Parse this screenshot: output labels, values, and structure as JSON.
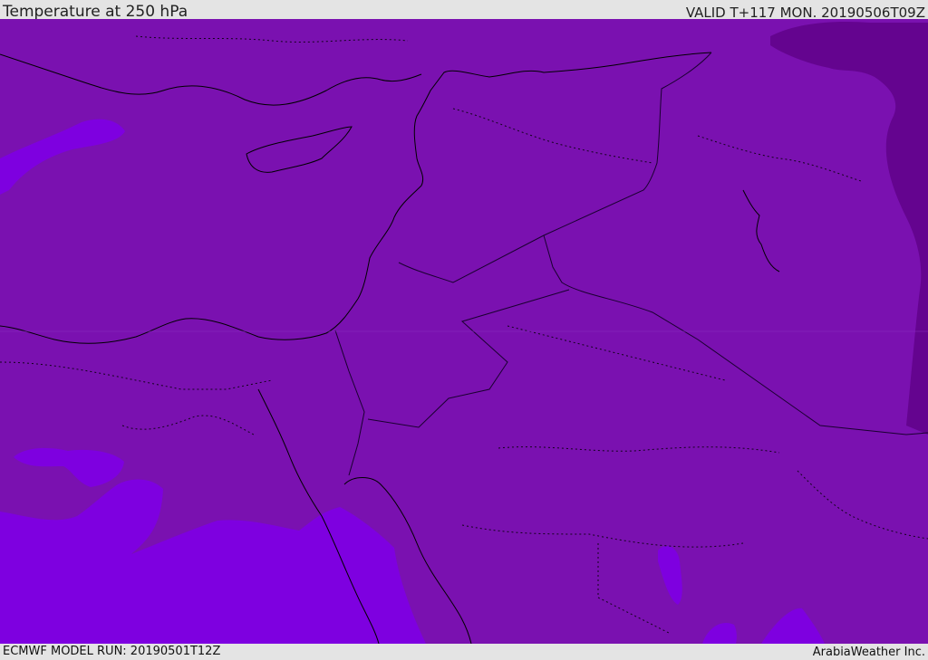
{
  "header": {
    "title": "Temperature at 250 hPa",
    "valid": "VALID T+117 MON. 20190506T09Z"
  },
  "footer": {
    "model_run": "ECMWF MODEL RUN: 20190501T12Z",
    "credit": "ArabiaWeather Inc."
  },
  "map": {
    "field": "temperature_250hPa",
    "colors": {
      "base_fill": "#7a11b0",
      "warm_patch": "#7e00e0",
      "cold_patch": "#63008f",
      "coast_line": "#000000",
      "border_line": "#1a0030"
    }
  }
}
